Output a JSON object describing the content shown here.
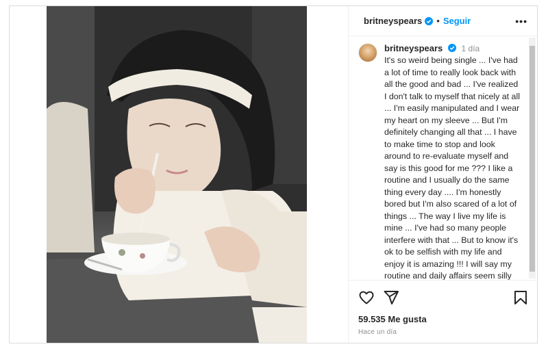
{
  "colors": {
    "accent": "#0095f6",
    "text": "#262626",
    "muted": "#8e8e8e",
    "border": "#dbdbdb"
  },
  "header": {
    "username": "britneyspears",
    "separator": "•",
    "follow_label": "Seguir",
    "more_label": "•••"
  },
  "post": {
    "username": "britneyspears",
    "time": "1 día",
    "caption": "It's so weird being single ... I've had a lot of time to really look back with all the good and bad ... I've realized I don't talk to myself that nicely at all ... I'm easily manipulated and I wear my heart on my sleeve ... But I'm definitely changing all that ... I have to make time to stop and look around to re-evaluate myself and say is this good for me ??? I like a routine and I usually do the same thing every day .... I'm honestly bored but I'm also scared of a lot of things ... The way I live my life is mine ... I've had so many people interfere with that ... But to know it's ok to be selfish with my life and enjoy it is amazing !!! I will say my routine and daily affairs seem silly sometimes ... My mom always use to visit the sisters at St. Mary's Catholic School ... She used to go to when I was younger and the nuns always gave me cookies ... I liked going there because the sun was always out and it was"
  },
  "icons": {
    "verified": "verified-badge-icon",
    "like": "heart-icon",
    "share": "paper-plane-icon",
    "save": "bookmark-icon"
  },
  "footer": {
    "likes": "59.535 Me gusta",
    "ago": "Hace un día"
  }
}
